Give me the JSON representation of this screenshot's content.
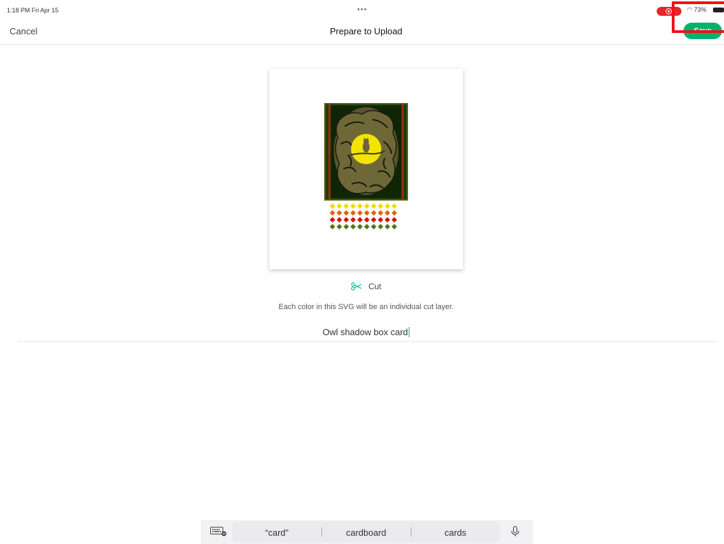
{
  "status_bar": {
    "time": "1:18 PM  Fri Apr 15",
    "dots": "•••",
    "right": "73%"
  },
  "nav": {
    "cancel_label": "Cancel",
    "title": "Prepare to Upload",
    "save_label": "Save"
  },
  "operation": {
    "label": "Cut",
    "hint": "Each color in this SVG will be an individual cut layer."
  },
  "project_name": {
    "value": "Owl shadow box card"
  },
  "suggestions": {
    "items": [
      "“card”",
      "cardboard",
      "cards"
    ]
  },
  "colors": {
    "accent": "#00b36b",
    "highlight": "#e8141c",
    "cut_icon": "#19c3a8"
  }
}
